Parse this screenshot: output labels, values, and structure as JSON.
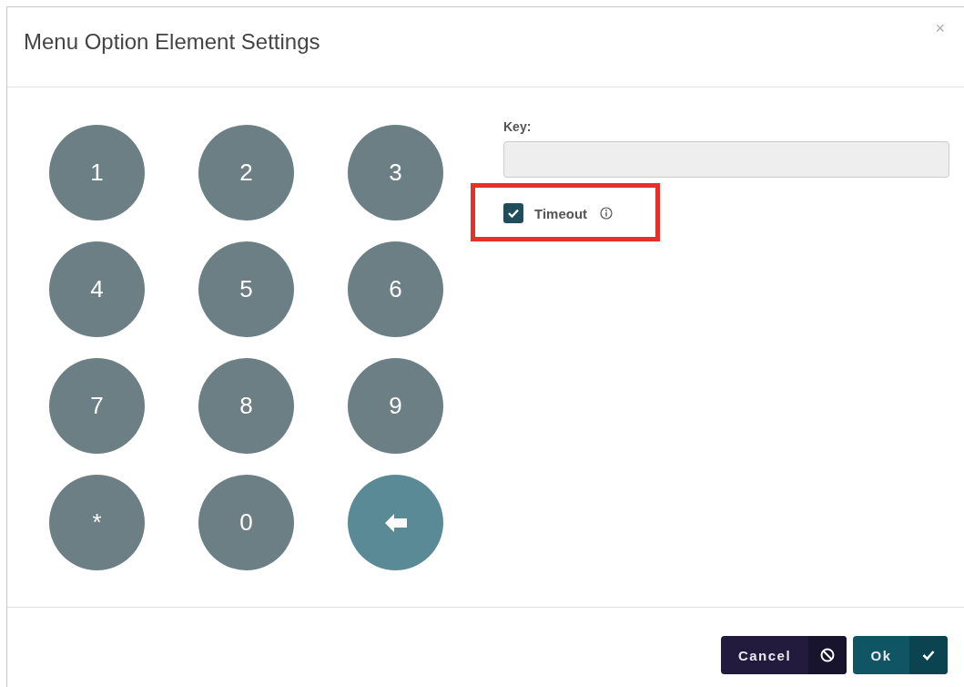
{
  "dialog": {
    "title": "Menu Option Element Settings",
    "close": "×"
  },
  "keypad": [
    {
      "kind": "digit",
      "label": "1"
    },
    {
      "kind": "digit",
      "label": "2"
    },
    {
      "kind": "digit",
      "label": "3"
    },
    {
      "kind": "digit",
      "label": "4"
    },
    {
      "kind": "digit",
      "label": "5"
    },
    {
      "kind": "digit",
      "label": "6"
    },
    {
      "kind": "digit",
      "label": "7"
    },
    {
      "kind": "digit",
      "label": "8"
    },
    {
      "kind": "digit",
      "label": "9"
    },
    {
      "kind": "digit",
      "label": "*"
    },
    {
      "kind": "digit",
      "label": "0"
    },
    {
      "kind": "backspace"
    }
  ],
  "key_field": {
    "label": "Key:"
  },
  "timeout": {
    "label": "Timeout",
    "checked": true,
    "highlighted": true
  },
  "buttons": [
    {
      "kind": "cancel",
      "label": "Cancel"
    },
    {
      "kind": "ok",
      "label": "Ok"
    }
  ]
}
